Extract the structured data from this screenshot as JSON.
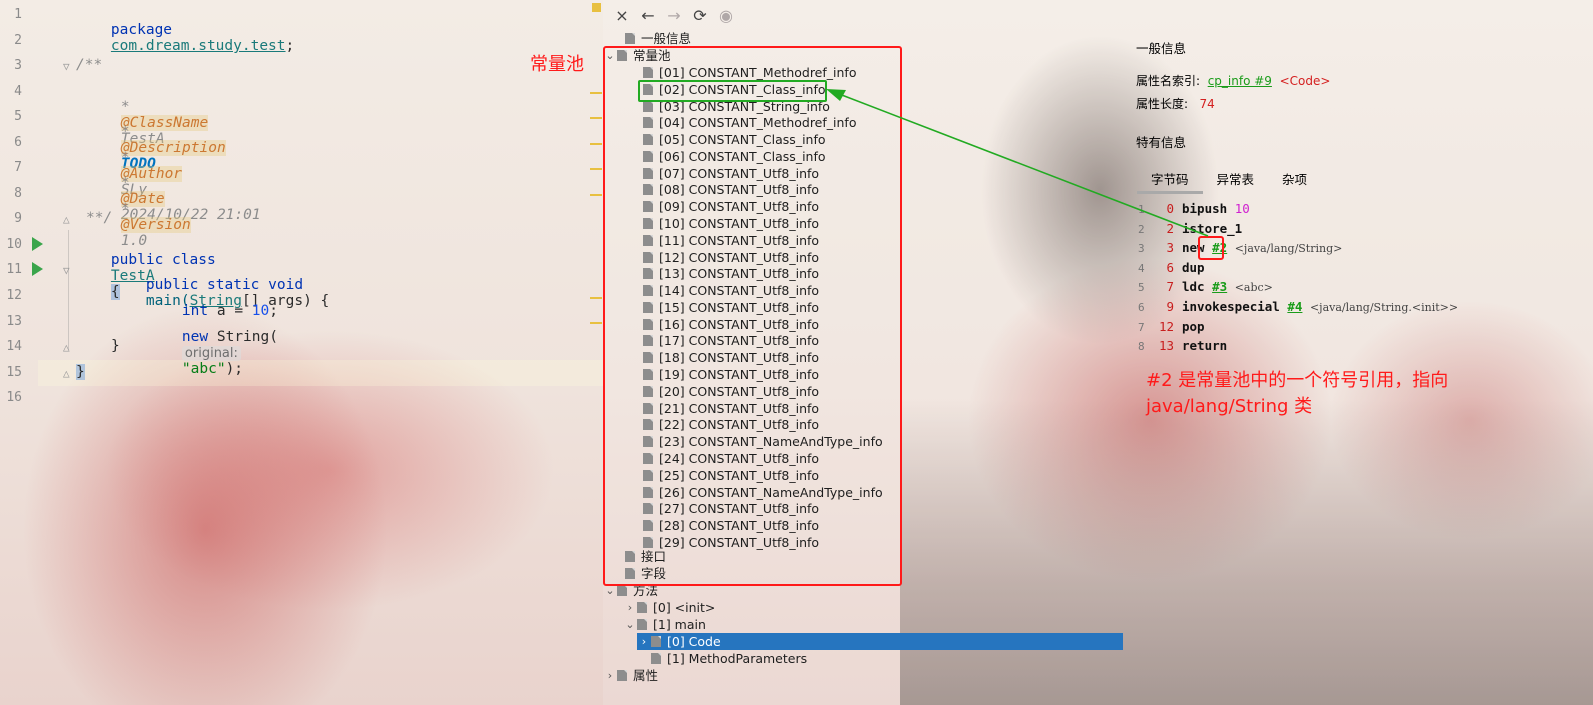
{
  "editor": {
    "line_numbers": [
      "1",
      "2",
      "3",
      "4",
      "5",
      "6",
      "7",
      "8",
      "9",
      "10",
      "11",
      "12",
      "13",
      "14",
      "15",
      "16"
    ],
    "package_kw": "package",
    "package_name": "com.dream.study.test",
    "semicolon": ";",
    "doc_open": "/**",
    "doc_star": "*",
    "tag_classname": "@ClassName",
    "val_classname": "TestA",
    "tag_description": "@Description",
    "val_description": "TODO",
    "tag_author": "@Author",
    "val_author": "SLy",
    "tag_date": "@Date",
    "val_date": "2024/10/22 21:01",
    "tag_version": "@Version",
    "val_version": "1.0",
    "doc_close": "**/",
    "class_kw": "public class",
    "class_name": "TestA",
    "open_brace": "{",
    "method_kw": "public static void",
    "method_name": "main(",
    "param_type": "String",
    "param_rest": "[] args) {",
    "int_kw": "int",
    "int_rest": " a = ",
    "int_val": "10",
    "new_kw": "new",
    "new_type": " String(",
    "hint_label": "original:",
    "str_val": "\"abc\"",
    "close_call": ");",
    "close_brace": "}",
    "close_brace_last": "}"
  },
  "toolbar": {
    "close_icon": "×",
    "back_icon": "←",
    "forward_icon": "→",
    "refresh_icon": "⟳",
    "browser_icon": "◉"
  },
  "tree": {
    "general": "一般信息",
    "constant_pool": "常量池",
    "constants": [
      "[01] CONSTANT_Methodref_info",
      "[02] CONSTANT_Class_info",
      "[03] CONSTANT_String_info",
      "[04] CONSTANT_Methodref_info",
      "[05] CONSTANT_Class_info",
      "[06] CONSTANT_Class_info",
      "[07] CONSTANT_Utf8_info",
      "[08] CONSTANT_Utf8_info",
      "[09] CONSTANT_Utf8_info",
      "[10] CONSTANT_Utf8_info",
      "[11] CONSTANT_Utf8_info",
      "[12] CONSTANT_Utf8_info",
      "[13] CONSTANT_Utf8_info",
      "[14] CONSTANT_Utf8_info",
      "[15] CONSTANT_Utf8_info",
      "[16] CONSTANT_Utf8_info",
      "[17] CONSTANT_Utf8_info",
      "[18] CONSTANT_Utf8_info",
      "[19] CONSTANT_Utf8_info",
      "[20] CONSTANT_Utf8_info",
      "[21] CONSTANT_Utf8_info",
      "[22] CONSTANT_Utf8_info",
      "[23] CONSTANT_NameAndType_info",
      "[24] CONSTANT_Utf8_info",
      "[25] CONSTANT_Utf8_info",
      "[26] CONSTANT_NameAndType_info",
      "[27] CONSTANT_Utf8_info",
      "[28] CONSTANT_Utf8_info",
      "[29] CONSTANT_Utf8_info"
    ],
    "interfaces": "接口",
    "fields": "字段",
    "methods": "方法",
    "method_init": "[0] <init>",
    "method_main": "[1] main",
    "code": "[0] Code",
    "method_params": "[1] MethodParameters",
    "attributes": "属性"
  },
  "panel": {
    "general_title": "一般信息",
    "name_index_label": "属性名索引:",
    "name_index_link": "cp_info #9",
    "name_index_value": "<Code>",
    "length_label": "属性长度:",
    "length_value": "74",
    "specific_title": "特有信息",
    "tabs": [
      "字节码",
      "异常表",
      "杂项"
    ],
    "bytecode": [
      {
        "ln": "1",
        "pc": "0",
        "op": "bipush",
        "arg": "10",
        "ref": "",
        "cmt": ""
      },
      {
        "ln": "2",
        "pc": "2",
        "op": "istore_1",
        "arg": "",
        "ref": "",
        "cmt": ""
      },
      {
        "ln": "3",
        "pc": "3",
        "op": "new",
        "arg": "",
        "ref": "#2",
        "cmt": "<java/lang/String>"
      },
      {
        "ln": "4",
        "pc": "6",
        "op": "dup",
        "arg": "",
        "ref": "",
        "cmt": ""
      },
      {
        "ln": "5",
        "pc": "7",
        "op": "ldc",
        "arg": "",
        "ref": "#3",
        "cmt": "<abc>"
      },
      {
        "ln": "6",
        "pc": "9",
        "op": "invokespecial",
        "arg": "",
        "ref": "#4",
        "cmt": "<java/lang/String.<init>>"
      },
      {
        "ln": "7",
        "pc": "12",
        "op": "pop",
        "arg": "",
        "ref": "",
        "cmt": ""
      },
      {
        "ln": "8",
        "pc": "13",
        "op": "return",
        "arg": "",
        "ref": "",
        "cmt": ""
      }
    ]
  },
  "annotations": {
    "pool_label": "常量池",
    "note_line1": "#2 是常量池中的一个符号引用，指向",
    "note_line2": "java/lang/String 类",
    "red_color": "#ff1a1a",
    "green_color": "#22aa22"
  }
}
